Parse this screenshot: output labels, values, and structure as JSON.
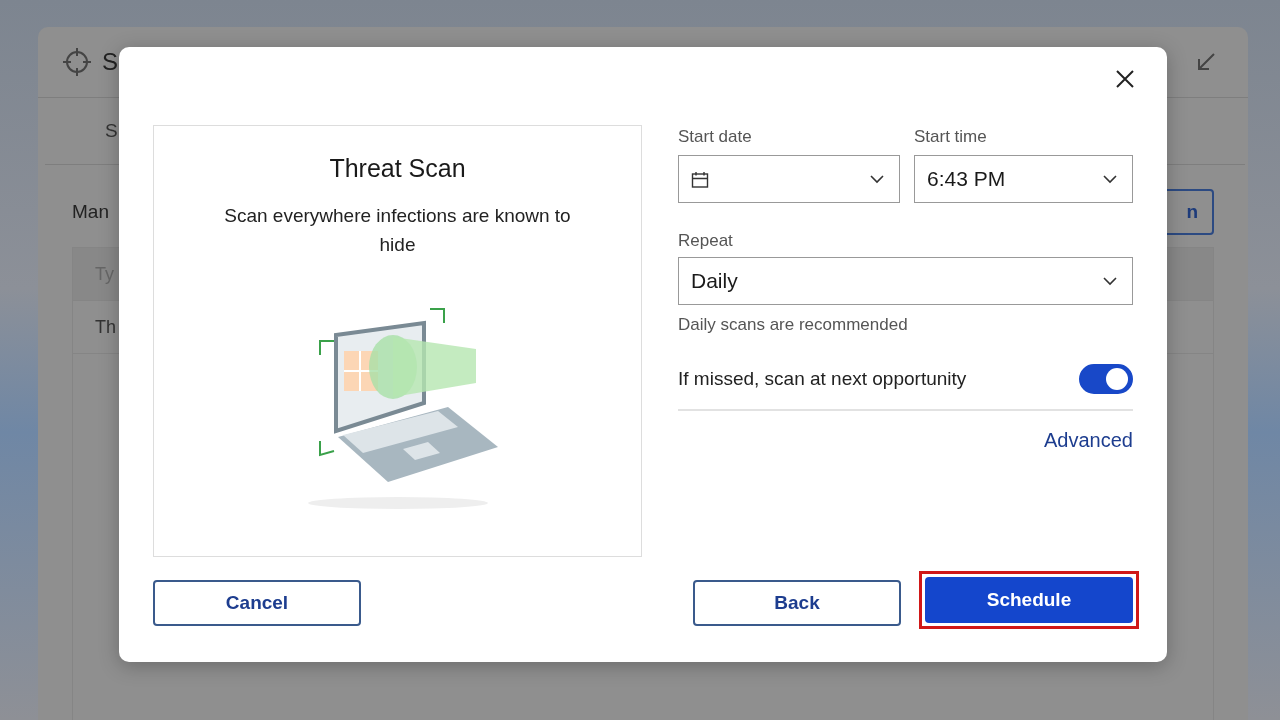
{
  "background_window": {
    "title": "S",
    "tabs": [
      {
        "label": "S"
      }
    ],
    "section_title": "Man",
    "button": "n",
    "table": {
      "columns": [
        "Ty"
      ],
      "rows": [
        [
          "Th"
        ]
      ]
    }
  },
  "dialog": {
    "card": {
      "title": "Threat Scan",
      "description": "Scan everywhere infections are known to hide"
    },
    "start_date": {
      "label": "Start date"
    },
    "start_time": {
      "label": "Start time",
      "value": "6:43 PM"
    },
    "repeat": {
      "label": "Repeat",
      "value": "Daily",
      "hint": "Daily scans are recommended"
    },
    "missed_option": {
      "label": "If missed, scan at next opportunity",
      "on": true
    },
    "advanced_link": "Advanced",
    "buttons": [
      {
        "label": "Cancel",
        "kind": "secondary",
        "highlighted": false
      },
      {
        "label": "Back",
        "kind": "secondary",
        "highlighted": false
      },
      {
        "label": "Schedule",
        "kind": "primary",
        "highlighted": true
      }
    ]
  }
}
